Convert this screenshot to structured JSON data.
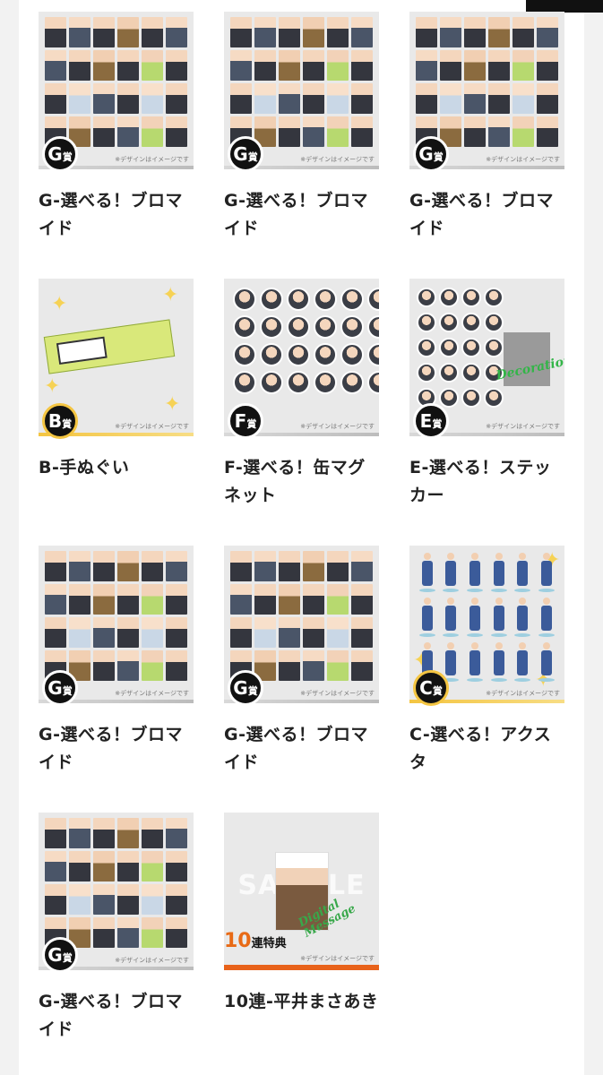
{
  "items": [
    {
      "title": "G-選べる！ブロマイド",
      "badge_letter": "G",
      "badge_suffix": "賞",
      "note": "※デザインはイメージです"
    },
    {
      "title": "G-選べる！ブロマイド",
      "badge_letter": "G",
      "badge_suffix": "賞",
      "note": "※デザインはイメージです"
    },
    {
      "title": "G-選べる！ブロマイド",
      "badge_letter": "G",
      "badge_suffix": "賞",
      "note": "※デザインはイメージです"
    },
    {
      "title": "B-手ぬぐい",
      "badge_letter": "B",
      "badge_suffix": "賞",
      "note": "※デザインはイメージです"
    },
    {
      "title": "F-選べる！缶マグネット",
      "badge_letter": "F",
      "badge_suffix": "賞",
      "note": "※デザインはイメージです"
    },
    {
      "title": "E-選べる！ステッカー",
      "badge_letter": "E",
      "badge_suffix": "賞",
      "note": "※デザインはイメージです",
      "overlay_text": "Decoration"
    },
    {
      "title": "G-選べる！ブロマイド",
      "badge_letter": "G",
      "badge_suffix": "賞",
      "note": "※デザインはイメージです"
    },
    {
      "title": "G-選べる！ブロマイド",
      "badge_letter": "G",
      "badge_suffix": "賞",
      "note": "※デザインはイメージです"
    },
    {
      "title": "C-選べる！アクスタ",
      "badge_letter": "C",
      "badge_suffix": "賞",
      "note": "※デザインはイメージです"
    },
    {
      "title": "G-選べる！ブロマイド",
      "badge_letter": "G",
      "badge_suffix": "賞",
      "note": "※デザインはイメージです"
    },
    {
      "title": "10連-平井まさあき",
      "badge_number": "10",
      "badge_suffix": "連特典",
      "note": "※デザインはイメージです",
      "watermark": "SAMPLE",
      "overlay_text": "Digital Message"
    }
  ],
  "colors": {
    "accent_orange": "#e8621a",
    "gold": "#f4c542",
    "badge_black": "#111111",
    "green": "#38a84a"
  }
}
